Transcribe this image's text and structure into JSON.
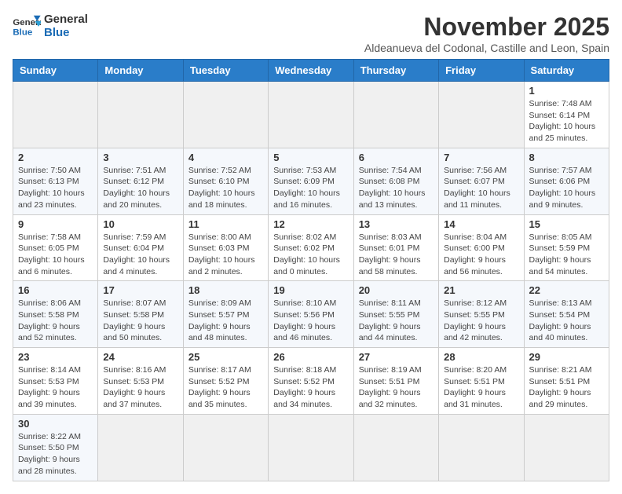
{
  "header": {
    "logo_line1": "General",
    "logo_line2": "Blue",
    "title": "November 2025",
    "subtitle": "Aldeanueva del Codonal, Castille and Leon, Spain"
  },
  "weekdays": [
    "Sunday",
    "Monday",
    "Tuesday",
    "Wednesday",
    "Thursday",
    "Friday",
    "Saturday"
  ],
  "weeks": [
    [
      {
        "day": "",
        "info": ""
      },
      {
        "day": "",
        "info": ""
      },
      {
        "day": "",
        "info": ""
      },
      {
        "day": "",
        "info": ""
      },
      {
        "day": "",
        "info": ""
      },
      {
        "day": "",
        "info": ""
      },
      {
        "day": "1",
        "info": "Sunrise: 7:48 AM\nSunset: 6:14 PM\nDaylight: 10 hours and 25 minutes."
      }
    ],
    [
      {
        "day": "2",
        "info": "Sunrise: 7:50 AM\nSunset: 6:13 PM\nDaylight: 10 hours and 23 minutes."
      },
      {
        "day": "3",
        "info": "Sunrise: 7:51 AM\nSunset: 6:12 PM\nDaylight: 10 hours and 20 minutes."
      },
      {
        "day": "4",
        "info": "Sunrise: 7:52 AM\nSunset: 6:10 PM\nDaylight: 10 hours and 18 minutes."
      },
      {
        "day": "5",
        "info": "Sunrise: 7:53 AM\nSunset: 6:09 PM\nDaylight: 10 hours and 16 minutes."
      },
      {
        "day": "6",
        "info": "Sunrise: 7:54 AM\nSunset: 6:08 PM\nDaylight: 10 hours and 13 minutes."
      },
      {
        "day": "7",
        "info": "Sunrise: 7:56 AM\nSunset: 6:07 PM\nDaylight: 10 hours and 11 minutes."
      },
      {
        "day": "8",
        "info": "Sunrise: 7:57 AM\nSunset: 6:06 PM\nDaylight: 10 hours and 9 minutes."
      }
    ],
    [
      {
        "day": "9",
        "info": "Sunrise: 7:58 AM\nSunset: 6:05 PM\nDaylight: 10 hours and 6 minutes."
      },
      {
        "day": "10",
        "info": "Sunrise: 7:59 AM\nSunset: 6:04 PM\nDaylight: 10 hours and 4 minutes."
      },
      {
        "day": "11",
        "info": "Sunrise: 8:00 AM\nSunset: 6:03 PM\nDaylight: 10 hours and 2 minutes."
      },
      {
        "day": "12",
        "info": "Sunrise: 8:02 AM\nSunset: 6:02 PM\nDaylight: 10 hours and 0 minutes."
      },
      {
        "day": "13",
        "info": "Sunrise: 8:03 AM\nSunset: 6:01 PM\nDaylight: 9 hours and 58 minutes."
      },
      {
        "day": "14",
        "info": "Sunrise: 8:04 AM\nSunset: 6:00 PM\nDaylight: 9 hours and 56 minutes."
      },
      {
        "day": "15",
        "info": "Sunrise: 8:05 AM\nSunset: 5:59 PM\nDaylight: 9 hours and 54 minutes."
      }
    ],
    [
      {
        "day": "16",
        "info": "Sunrise: 8:06 AM\nSunset: 5:58 PM\nDaylight: 9 hours and 52 minutes."
      },
      {
        "day": "17",
        "info": "Sunrise: 8:07 AM\nSunset: 5:58 PM\nDaylight: 9 hours and 50 minutes."
      },
      {
        "day": "18",
        "info": "Sunrise: 8:09 AM\nSunset: 5:57 PM\nDaylight: 9 hours and 48 minutes."
      },
      {
        "day": "19",
        "info": "Sunrise: 8:10 AM\nSunset: 5:56 PM\nDaylight: 9 hours and 46 minutes."
      },
      {
        "day": "20",
        "info": "Sunrise: 8:11 AM\nSunset: 5:55 PM\nDaylight: 9 hours and 44 minutes."
      },
      {
        "day": "21",
        "info": "Sunrise: 8:12 AM\nSunset: 5:55 PM\nDaylight: 9 hours and 42 minutes."
      },
      {
        "day": "22",
        "info": "Sunrise: 8:13 AM\nSunset: 5:54 PM\nDaylight: 9 hours and 40 minutes."
      }
    ],
    [
      {
        "day": "23",
        "info": "Sunrise: 8:14 AM\nSunset: 5:53 PM\nDaylight: 9 hours and 39 minutes."
      },
      {
        "day": "24",
        "info": "Sunrise: 8:16 AM\nSunset: 5:53 PM\nDaylight: 9 hours and 37 minutes."
      },
      {
        "day": "25",
        "info": "Sunrise: 8:17 AM\nSunset: 5:52 PM\nDaylight: 9 hours and 35 minutes."
      },
      {
        "day": "26",
        "info": "Sunrise: 8:18 AM\nSunset: 5:52 PM\nDaylight: 9 hours and 34 minutes."
      },
      {
        "day": "27",
        "info": "Sunrise: 8:19 AM\nSunset: 5:51 PM\nDaylight: 9 hours and 32 minutes."
      },
      {
        "day": "28",
        "info": "Sunrise: 8:20 AM\nSunset: 5:51 PM\nDaylight: 9 hours and 31 minutes."
      },
      {
        "day": "29",
        "info": "Sunrise: 8:21 AM\nSunset: 5:51 PM\nDaylight: 9 hours and 29 minutes."
      }
    ],
    [
      {
        "day": "30",
        "info": "Sunrise: 8:22 AM\nSunset: 5:50 PM\nDaylight: 9 hours and 28 minutes."
      },
      {
        "day": "",
        "info": ""
      },
      {
        "day": "",
        "info": ""
      },
      {
        "day": "",
        "info": ""
      },
      {
        "day": "",
        "info": ""
      },
      {
        "day": "",
        "info": ""
      },
      {
        "day": "",
        "info": ""
      }
    ]
  ]
}
